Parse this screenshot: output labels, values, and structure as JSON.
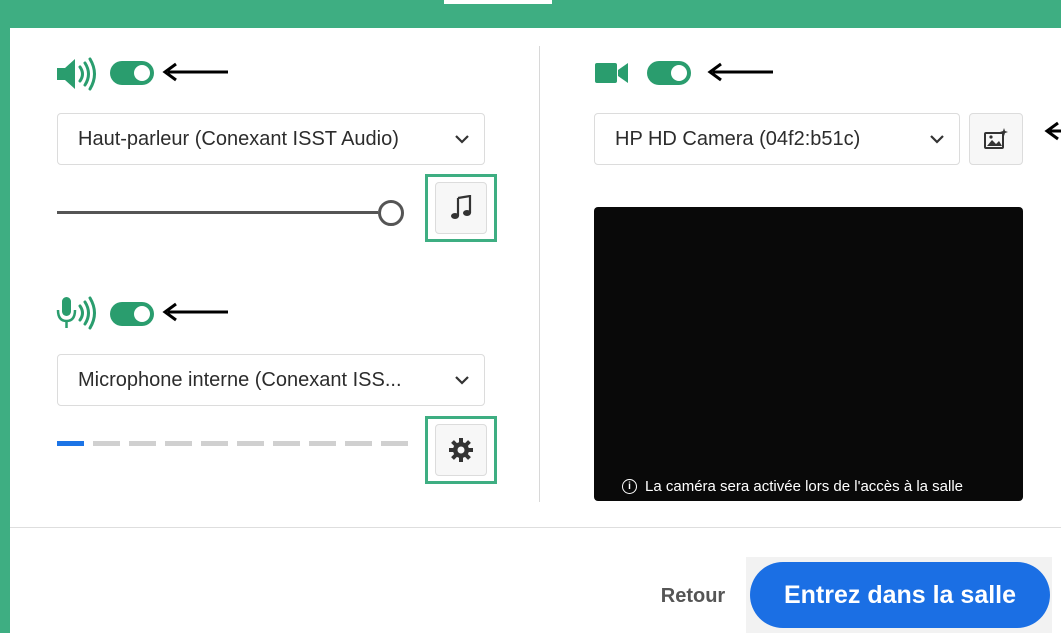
{
  "audio": {
    "speaker_select": {
      "value": "Haut-parleur (Conexant ISST Audio)"
    },
    "speaker_toggle_on": true,
    "volume_level": 1.0,
    "mic_select": {
      "value": "Microphone interne (Conexant ISS..."
    },
    "mic_toggle_on": true,
    "mic_level_active_segments": 1,
    "mic_level_total_segments": 10
  },
  "video": {
    "camera_select": {
      "value": "HP HD Camera (04f2:b51c)"
    },
    "camera_toggle_on": true,
    "preview_note": "La caméra sera activée lors de l'accès à la salle"
  },
  "footer": {
    "back_label": "Retour",
    "enter_label": "Entrez dans la salle"
  },
  "colors": {
    "accent_green": "#3eae82",
    "toggle_green": "#2a9d6e",
    "primary_blue": "#1b6fe4",
    "level_blue": "#1c74e6"
  },
  "icons": [
    "speaker-icon",
    "microphone-icon",
    "video-camera-icon",
    "chevron-down-icon",
    "music-note-icon",
    "gear-icon",
    "background-effects-icon",
    "info-icon",
    "arrow-left-icon"
  ]
}
